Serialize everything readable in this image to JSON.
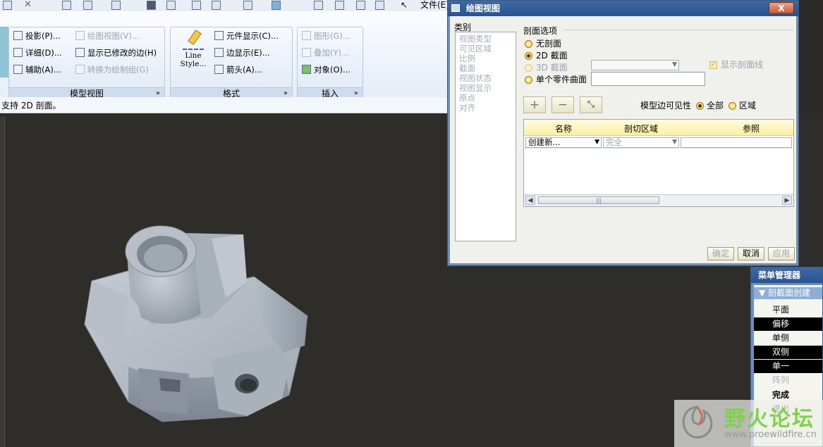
{
  "toolbar": {
    "file_label": "文件(E)"
  },
  "ribbon": {
    "groups": [
      {
        "label": "模型视图",
        "items": [
          {
            "label": "投影(P)..."
          },
          {
            "label": "绘图视图(V)...",
            "disabled": true
          },
          {
            "label": "详细(D)..."
          },
          {
            "label": "显示已修改的边(H)"
          },
          {
            "label": "辅助(A)..."
          },
          {
            "label": "转换为绘制组(G)",
            "disabled": true
          }
        ]
      },
      {
        "label": "格式",
        "items": [
          {
            "label": "Line Style..."
          },
          {
            "label": "元件显示(C)..."
          },
          {
            "label": "边显示(E)..."
          },
          {
            "label": "箭头(A)..."
          }
        ]
      },
      {
        "label": "插入",
        "items": [
          {
            "label": "图形(G)...",
            "disabled": true
          },
          {
            "label": "叠加(Y)...",
            "disabled": true
          },
          {
            "label": "对象(O)..."
          }
        ]
      }
    ]
  },
  "status": {
    "message": "支持 2D 剖面。"
  },
  "dialog": {
    "title": "绘图视图",
    "close_label": "X",
    "category_label": "类别",
    "categories": [
      "视图类型",
      "可见区域",
      "比例",
      "截面",
      "视图状态",
      "视图显示",
      "原点",
      "对齐"
    ],
    "section_options_label": "剖面选项",
    "options": {
      "no_section": "无剖面",
      "section_2d": "2D 截面",
      "section_3d": "3D 截面",
      "single_part_surface": "单个零件曲面"
    },
    "show_section_lines_label": "显示剖面线",
    "add_symbol": "+",
    "remove_symbol": "−",
    "model_edge_visibility_label": "模型边可见性",
    "visibility_all": "全部",
    "visibility_area": "区域",
    "table": {
      "headers": [
        "名称",
        "剖切区域",
        "参照"
      ],
      "row": {
        "name": "创建新...",
        "area": "完全",
        "reference": ""
      }
    },
    "buttons": {
      "ok": "确定",
      "cancel": "取消",
      "apply": "应用"
    }
  },
  "menu_manager": {
    "title": "菜单管理器",
    "header": "剖截面创建",
    "items": [
      {
        "label": "平面",
        "selected": false,
        "disabled": false
      },
      {
        "label": "偏移",
        "selected": true,
        "disabled": false
      },
      {
        "label": "单侧",
        "selected": false,
        "disabled": false
      },
      {
        "label": "双侧",
        "selected": true,
        "disabled": false
      },
      {
        "label": "单一",
        "selected": true,
        "disabled": false
      },
      {
        "label": "阵列",
        "selected": false,
        "disabled": true
      },
      {
        "label": "完成",
        "selected": false,
        "disabled": false
      },
      {
        "label": "退出",
        "selected": false,
        "disabled": false
      }
    ]
  },
  "watermark": {
    "text": "野火论坛",
    "url": "www.proewildfire.cn"
  },
  "colors": {
    "viewport_bg": "#2e2d2a",
    "part_gray": "#a4acb6",
    "titlebar_blue": "#2f5c99",
    "table_header_yellow": "#fdf0a2",
    "radio_yellow": "#f0c94a",
    "watermark_green": "#7fd04a"
  }
}
